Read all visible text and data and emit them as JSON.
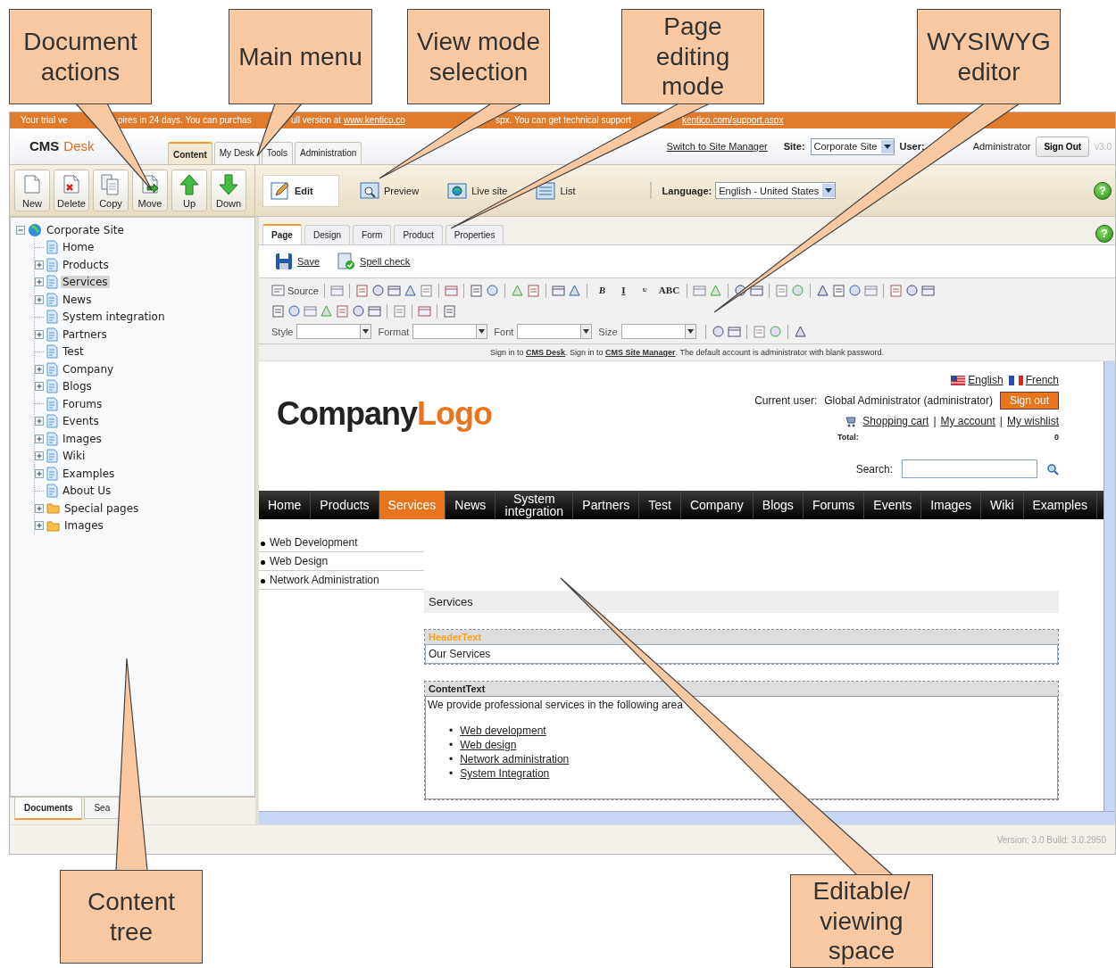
{
  "callouts": [
    {
      "text": "Document actions"
    },
    {
      "text": "Main menu"
    },
    {
      "text": "View mode selection"
    },
    {
      "text": "Page editing mode"
    },
    {
      "text": "WYSIWYG editor"
    },
    {
      "text": "Content tree"
    },
    {
      "text": "Editable/ viewing space"
    }
  ],
  "trial_bar": {
    "segments": [
      {
        "kind": "text",
        "text": "Your trial ve"
      },
      {
        "kind": "text",
        "text": "pires in 24 days. You can purchas"
      },
      {
        "kind": "mixed",
        "text": "ull version at ",
        "link": "www.kentico.co"
      },
      {
        "kind": "text",
        "text": "spx. You can get technical support"
      },
      {
        "kind": "link",
        "text": "kentico.com/support.aspx"
      }
    ]
  },
  "header": {
    "logo_left": "CMS",
    "logo_right": "Desk",
    "tabs": [
      {
        "label": "Content",
        "selected": true
      },
      {
        "label": "My Desk",
        "selected": false
      },
      {
        "label": "Tools",
        "selected": false
      },
      {
        "label": "Administration",
        "selected": false
      }
    ],
    "site_manager_link": "Switch to Site Manager",
    "site_label": "Site:",
    "site_value": "Corporate Site",
    "user_label": "User:",
    "user_value": "Administrator",
    "sign_out": "Sign Out",
    "version": "v3.0"
  },
  "actions": [
    {
      "kind": "new",
      "label": "New"
    },
    {
      "kind": "delete",
      "label": "Delete"
    },
    {
      "kind": "copy",
      "label": "Copy"
    },
    {
      "kind": "move",
      "label": "Move"
    },
    {
      "kind": "up",
      "label": "Up"
    },
    {
      "kind": "down",
      "label": "Down"
    }
  ],
  "view_modes": [
    {
      "kind": "edit",
      "label": "Edit",
      "selected": true
    },
    {
      "kind": "preview",
      "label": "Preview",
      "selected": false
    },
    {
      "kind": "live",
      "label": "Live site",
      "selected": false
    },
    {
      "kind": "list",
      "label": "List",
      "selected": false
    }
  ],
  "language": {
    "label": "Language:",
    "value": "English - United States"
  },
  "help": "?",
  "tree": {
    "label": "Corporate Site",
    "expanded": true,
    "children": [
      {
        "label": "Home",
        "kind": "page",
        "expander": false,
        "selected": false
      },
      {
        "label": "Products",
        "kind": "page",
        "expander": true,
        "selected": false
      },
      {
        "label": "Services",
        "kind": "page",
        "expander": true,
        "selected": true
      },
      {
        "label": "News",
        "kind": "page",
        "expander": true,
        "selected": false
      },
      {
        "label": "System integration",
        "kind": "page",
        "expander": false,
        "selected": false
      },
      {
        "label": "Partners",
        "kind": "page",
        "expander": true,
        "selected": false
      },
      {
        "label": "Test",
        "kind": "page",
        "expander": false,
        "selected": false
      },
      {
        "label": "Company",
        "kind": "page",
        "expander": true,
        "selected": false
      },
      {
        "label": "Blogs",
        "kind": "page",
        "expander": true,
        "selected": false
      },
      {
        "label": "Forums",
        "kind": "page",
        "expander": false,
        "selected": false
      },
      {
        "label": "Events",
        "kind": "page",
        "expander": true,
        "selected": false
      },
      {
        "label": "Images",
        "kind": "page",
        "expander": true,
        "selected": false
      },
      {
        "label": "Wiki",
        "kind": "page",
        "expander": true,
        "selected": false
      },
      {
        "label": "Examples",
        "kind": "page",
        "expander": true,
        "selected": false
      },
      {
        "label": "About Us",
        "kind": "page",
        "expander": false,
        "selected": false
      },
      {
        "label": "Special pages",
        "kind": "folder",
        "expander": true,
        "selected": false
      },
      {
        "label": "Images",
        "kind": "folder",
        "expander": true,
        "selected": false
      }
    ]
  },
  "sidebar_tabs": [
    {
      "label": "Documents",
      "selected": true
    },
    {
      "label": "Sea",
      "selected": false
    }
  ],
  "edit_tabs": [
    {
      "label": "Page",
      "selected": true
    },
    {
      "label": "Design",
      "selected": false
    },
    {
      "label": "Form",
      "selected": false
    },
    {
      "label": "Product",
      "selected": false
    },
    {
      "label": "Properties",
      "selected": false
    }
  ],
  "edit_actions": [
    {
      "kind": "save",
      "label": "Save"
    },
    {
      "kind": "spell",
      "label": "Spell check"
    }
  ],
  "editor_toolbar": {
    "rows": [
      [
        {
          "kind": "source",
          "label": "Source"
        },
        {
          "kind": "sep"
        },
        {
          "kind": "icon"
        },
        {
          "kind": "sep"
        },
        {
          "kind": "icon"
        },
        {
          "kind": "icon"
        },
        {
          "kind": "icon"
        },
        {
          "kind": "icon"
        },
        {
          "kind": "icon"
        },
        {
          "kind": "sep"
        },
        {
          "kind": "icon"
        },
        {
          "kind": "sep"
        },
        {
          "kind": "icon"
        },
        {
          "kind": "icon"
        },
        {
          "kind": "sep"
        },
        {
          "kind": "icon"
        },
        {
          "kind": "icon"
        },
        {
          "kind": "sep"
        },
        {
          "kind": "icon"
        },
        {
          "kind": "icon"
        },
        {
          "kind": "sep"
        },
        {
          "kind": "text",
          "label": "B"
        },
        {
          "kind": "text",
          "label": "I"
        },
        {
          "kind": "text",
          "label": "U"
        },
        {
          "kind": "text",
          "label": "ABC"
        },
        {
          "kind": "sep"
        },
        {
          "kind": "icon"
        },
        {
          "kind": "icon"
        },
        {
          "kind": "sep"
        },
        {
          "kind": "icon"
        },
        {
          "kind": "icon"
        },
        {
          "kind": "sep"
        },
        {
          "kind": "icon"
        },
        {
          "kind": "icon"
        },
        {
          "kind": "sep"
        },
        {
          "kind": "icon"
        },
        {
          "kind": "icon"
        },
        {
          "kind": "icon"
        },
        {
          "kind": "icon"
        },
        {
          "kind": "sep"
        },
        {
          "kind": "icon"
        },
        {
          "kind": "icon"
        },
        {
          "kind": "icon"
        }
      ],
      [
        {
          "kind": "icon"
        },
        {
          "kind": "icon"
        },
        {
          "kind": "icon"
        },
        {
          "kind": "icon"
        },
        {
          "kind": "icon"
        },
        {
          "kind": "icon"
        },
        {
          "kind": "icon"
        },
        {
          "kind": "sep"
        },
        {
          "kind": "icon"
        },
        {
          "kind": "sep"
        },
        {
          "kind": "icon"
        },
        {
          "kind": "sep"
        },
        {
          "kind": "icon"
        }
      ],
      [
        {
          "kind": "combo",
          "label": "Style"
        },
        {
          "kind": "combo",
          "label": "Format"
        },
        {
          "kind": "combo",
          "label": "Font"
        },
        {
          "kind": "combo",
          "label": "Size"
        },
        {
          "kind": "sep"
        },
        {
          "kind": "icon"
        },
        {
          "kind": "icon"
        },
        {
          "kind": "sep"
        },
        {
          "kind": "icon"
        },
        {
          "kind": "icon"
        },
        {
          "kind": "sep"
        },
        {
          "kind": "icon"
        }
      ]
    ]
  },
  "notice": "Sign in to **CMS Desk**. Sign in to **CMS Site Manager**. The default account is administrator with blank password.",
  "site": {
    "logo_left": "Company",
    "logo_right": "Logo",
    "languages": [
      {
        "label": "English",
        "kind": "us"
      },
      {
        "label": "French",
        "kind": "fr"
      }
    ],
    "current_user_label": "Current user:",
    "current_user": "Global Administrator (administrator)",
    "sign_out": "Sign out",
    "links": [
      {
        "label": "Shopping cart",
        "separator": "|"
      },
      {
        "label": "My account",
        "separator": "|"
      },
      {
        "label": "My wishlist"
      }
    ],
    "total_label": "Total:",
    "total_value": "0",
    "search_label": "Search:",
    "menu": [
      {
        "label": "Home",
        "selected": false
      },
      {
        "label": "Products",
        "selected": false
      },
      {
        "label": "Services",
        "selected": true
      },
      {
        "label": "News",
        "selected": false
      },
      {
        "label": "System integration",
        "selected": false
      },
      {
        "label": "Partners",
        "selected": false
      },
      {
        "label": "Test",
        "selected": false
      },
      {
        "label": "Company",
        "selected": false
      },
      {
        "label": "Blogs",
        "selected": false
      },
      {
        "label": "Forums",
        "selected": false
      },
      {
        "label": "Events",
        "selected": false
      },
      {
        "label": "Images",
        "selected": false
      },
      {
        "label": "Wiki",
        "selected": false
      },
      {
        "label": "Examples",
        "selected": false
      }
    ],
    "left_menu": [
      "Web Development",
      "Web Design",
      "Network Administration"
    ],
    "title": "Services",
    "header_field": {
      "label": "HeaderText",
      "value": "Our Services"
    },
    "content_field": {
      "label": "ContentText",
      "bullet": "•",
      "intro": "We provide professional services in the following area",
      "items": [
        "Web development",
        "Web design",
        "Network administration",
        "System Integration"
      ]
    }
  },
  "status_bar": "Version: 3.0 Build: 3.0.2950"
}
